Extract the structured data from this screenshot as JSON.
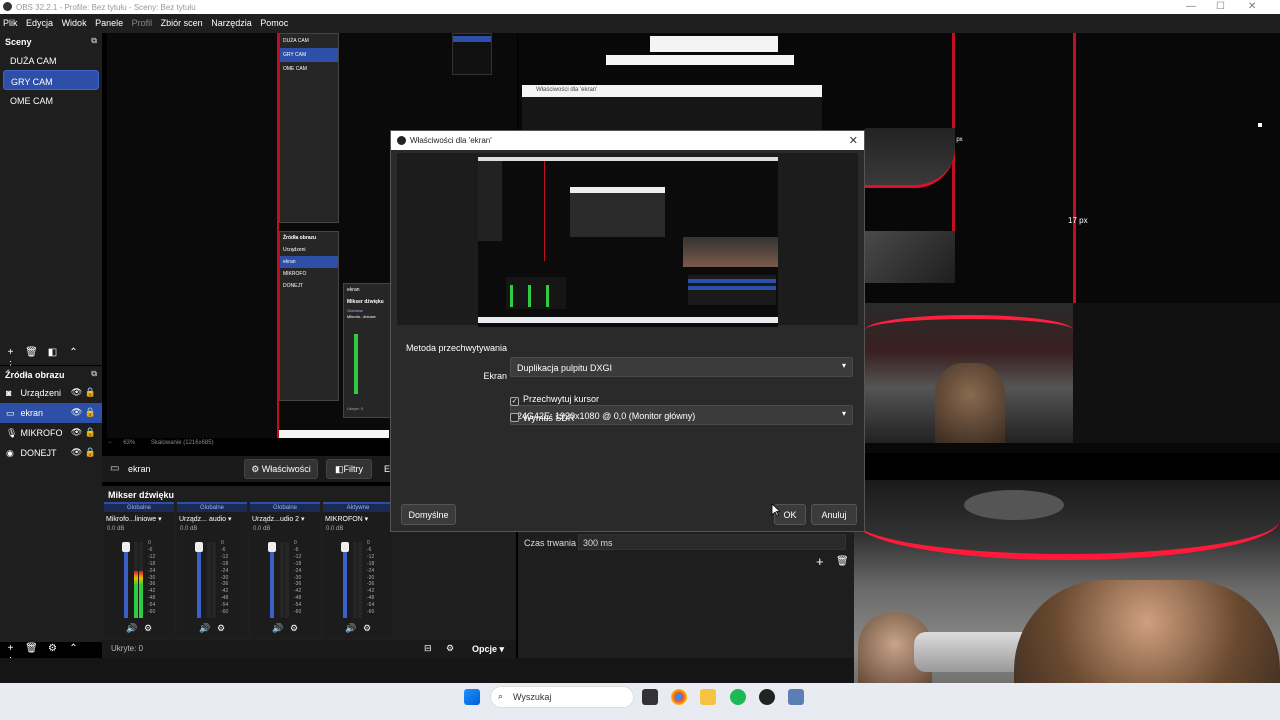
{
  "window": {
    "title": "OBS 32.2.1 - Profile: Bez tytułu - Sceny: Bez tytułu"
  },
  "menu": [
    "Plik",
    "Edycja",
    "Widok",
    "Panele",
    "Profil",
    "Zbiór scen",
    "Narzędzia",
    "Pomoc"
  ],
  "scenes": {
    "header": "Sceny",
    "items": [
      "DUŻA CAM",
      "GRY CAM",
      "OME CAM"
    ],
    "selected": 1
  },
  "sources": {
    "header": "Źródła obrazu",
    "items": [
      "Urządzeni",
      "ekran",
      "MIKROFO",
      "DONEJT"
    ],
    "selected": 1
  },
  "statusbar": {
    "zoom": "63%",
    "scale": "Skalowanie (1216x685)"
  },
  "source_toolbar": {
    "source": "ekran",
    "properties": "Właściwości",
    "filters": "Filtry",
    "more": "E"
  },
  "mixer": {
    "header": "Mikser dźwięku",
    "channels": [
      {
        "group": "Globalne",
        "name": "Mikrofo...liniowe",
        "db": "0.0 dB",
        "level": 0.62
      },
      {
        "group": "Globalne",
        "name": "Urządz... audio",
        "db": "0.0 dB",
        "level": 0
      },
      {
        "group": "Globalne",
        "name": "Urządz...udio 2",
        "db": "0.0 dB",
        "level": 0
      },
      {
        "group": "Aktywne",
        "name": "MIKROFON",
        "db": "0.0 dB",
        "level": 0
      }
    ],
    "ticks": [
      "0",
      "-6",
      "-12",
      "-18",
      "-24",
      "-30",
      "-36",
      "-42",
      "-48",
      "-54",
      "-60"
    ],
    "hidden": "Ukryte: 0",
    "options": "Opcje"
  },
  "transition": {
    "duration_label": "Czas trwania",
    "duration_value": "300 ms"
  },
  "dialog": {
    "title": "Właściwości dla 'ekran'",
    "method_label": "Metoda przechwytywania",
    "method_value": "Duplikacja pulpitu DXGI",
    "screen_label": "Ekran",
    "screen_value": "24G42E: 1920x1080 @ 0,0 (Monitor główny)",
    "capture_cursor": "Przechwytuj kursor",
    "capture_cursor_checked": true,
    "force_sdr": "Wymuś SDR",
    "force_sdr_checked": false,
    "defaults": "Domyślne",
    "ok": "OK",
    "cancel": "Anuluj"
  },
  "preview_right": {
    "measure1": "17 px",
    "measure2": "17 px"
  },
  "nested": {
    "scenes": [
      "DUŻA CAM",
      "GRY CAM",
      "OME CAM"
    ],
    "sources_header": "Źródła obrazu",
    "sources": [
      "Urządzeni",
      "ekran",
      "MIKROFO",
      "DONEJT"
    ],
    "source": "ekran",
    "mixer": "Mikser dźwięku",
    "group": "Globalne",
    "mic": "Mikrofo...liniowe",
    "hidden": "Ukryte: 0",
    "window_title": "Właściwości dla 'ekran'"
  },
  "taskbar": {
    "search": "Wyszukaj"
  },
  "colors": {
    "accent": "#2d4fa8",
    "red": "#e0102a",
    "panel": "#1e1e1e",
    "meter_green": "#2ecc40"
  }
}
